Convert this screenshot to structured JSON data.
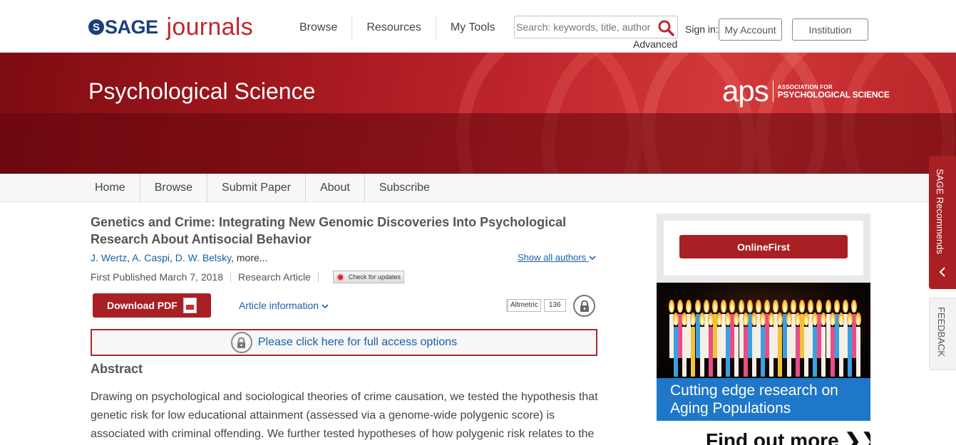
{
  "header": {
    "logo_sage": "SAGE",
    "logo_journals": "journals",
    "nav": [
      "Browse",
      "Resources",
      "My Tools"
    ],
    "search_placeholder": "Search: keywords, title, author",
    "advanced_label": "Advanced",
    "signin_label": "Sign in:",
    "my_account_label": "My Account",
    "institution_label": "Institution"
  },
  "banner": {
    "journal_title": "Psychological Science",
    "aps_letters": "aps",
    "aps_line1": "ASSOCIATION FOR",
    "aps_line2": "PSYCHOLOGICAL SCIENCE"
  },
  "journal_nav": [
    "Home",
    "Browse",
    "Submit Paper",
    "About",
    "Subscribe"
  ],
  "article": {
    "title": "Genetics and Crime: Integrating New Genomic Discoveries Into Psychological Research About Antisocial Behavior",
    "authors": [
      "J. Wertz",
      "A. Caspi",
      "D. W. Belsky"
    ],
    "authors_more": "more...",
    "show_all_authors": "Show all authors",
    "first_published": "First Published March 7, 2018",
    "article_type": "Research Article",
    "check_updates": "Check for updates",
    "download_pdf": "Download PDF",
    "article_information": "Article information",
    "altmetric_label": "Altmetric",
    "altmetric_score": "136",
    "access_text": "Please click here for full access options",
    "abstract_heading": "Abstract",
    "abstract_text": "Drawing on psychological and sociological theories of crime causation, we tested the hypothesis that genetic risk for low educational attainment (assessed via a genome-wide polygenic score) is associated with criminal offending. We further tested hypotheses of how polygenic risk relates to the"
  },
  "sidebar": {
    "onlinefirst_label": "OnlineFirst",
    "ad_text_line1": "Cutting edge research on",
    "ad_text_line2": "Aging Populations",
    "ad_find_more": "Find out more ❯❯"
  },
  "side_tabs": {
    "recommends": "SAGE Recommends",
    "feedback": "FEEDBACK"
  },
  "colors": {
    "brand_red": "#a81f24",
    "sage_blue": "#1c3f7a",
    "link_blue": "#1a5fa8",
    "ad_blue": "#1e77c8"
  }
}
